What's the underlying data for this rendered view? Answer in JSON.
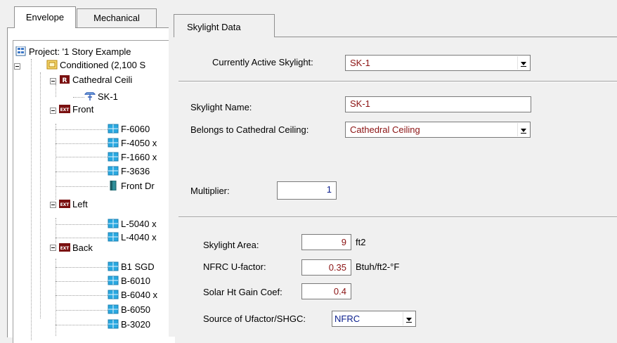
{
  "left_tabs": [
    {
      "label": "Envelope",
      "active": true
    },
    {
      "label": "Mechanical",
      "active": false
    }
  ],
  "tree": [
    {
      "label": "Project:  '1 Story Example",
      "icon": "project-icon",
      "level": 0
    },
    {
      "label": "Conditioned  (2,100 S",
      "icon": "zone-icon",
      "level": 1
    },
    {
      "label": "Cathedral Ceili",
      "icon": "roof-icon",
      "level": 2
    },
    {
      "label": "SK-1",
      "icon": "skylight-icon",
      "level": 3
    },
    {
      "label": "Front",
      "icon": "exterior-wall-icon",
      "level": 2
    },
    {
      "label": "F-6060",
      "icon": "window-icon",
      "level": 3
    },
    {
      "label": "F-4050 x",
      "icon": "window-icon",
      "level": 3
    },
    {
      "label": "F-1660 x",
      "icon": "window-icon",
      "level": 3
    },
    {
      "label": "F-3636",
      "icon": "window-icon",
      "level": 3
    },
    {
      "label": "Front Dr",
      "icon": "door-icon",
      "level": 3
    },
    {
      "label": "Left",
      "icon": "exterior-wall-icon",
      "level": 2
    },
    {
      "label": "L-5040 x",
      "icon": "window-icon",
      "level": 3
    },
    {
      "label": "L-4040 x",
      "icon": "window-icon",
      "level": 3
    },
    {
      "label": "Back",
      "icon": "exterior-wall-icon",
      "level": 2
    },
    {
      "label": "B1 SGD",
      "icon": "window-icon",
      "level": 3
    },
    {
      "label": "B-6010",
      "icon": "window-icon",
      "level": 3
    },
    {
      "label": "B-6040 x",
      "icon": "window-icon",
      "level": 3
    },
    {
      "label": "B-6050",
      "icon": "window-icon",
      "level": 3
    },
    {
      "label": "B-3020",
      "icon": "window-icon",
      "level": 3
    }
  ],
  "icon_glyphs": {
    "roof": "R",
    "exterior_wall": "EXT"
  },
  "right_tab": {
    "label": "Skylight Data"
  },
  "form": {
    "active_skylight_label": "Currently Active Skylight:",
    "active_skylight_value": "SK-1",
    "name_label": "Skylight Name:",
    "name_value": "SK-1",
    "belongs_label": "Belongs to Cathedral Ceiling:",
    "belongs_value": "Cathedral Ceiling",
    "multiplier_label": "Multiplier:",
    "multiplier_value": "1",
    "area_label": "Skylight Area:",
    "area_value": "9",
    "area_unit": "ft2",
    "ufactor_label": "NFRC U-factor:",
    "ufactor_value": "0.35",
    "ufactor_unit": "Btuh/ft2-°F",
    "shgc_label": "Solar Ht Gain Coef:",
    "shgc_value": "0.4",
    "source_label": "Source of Ufactor/SHGC:",
    "source_value": "NFRC"
  },
  "colors": {
    "value_red": "#8b1212",
    "value_blue": "#0a1e8c",
    "window_icon": "#29a8e0",
    "wall_icon": "#7a1010"
  }
}
